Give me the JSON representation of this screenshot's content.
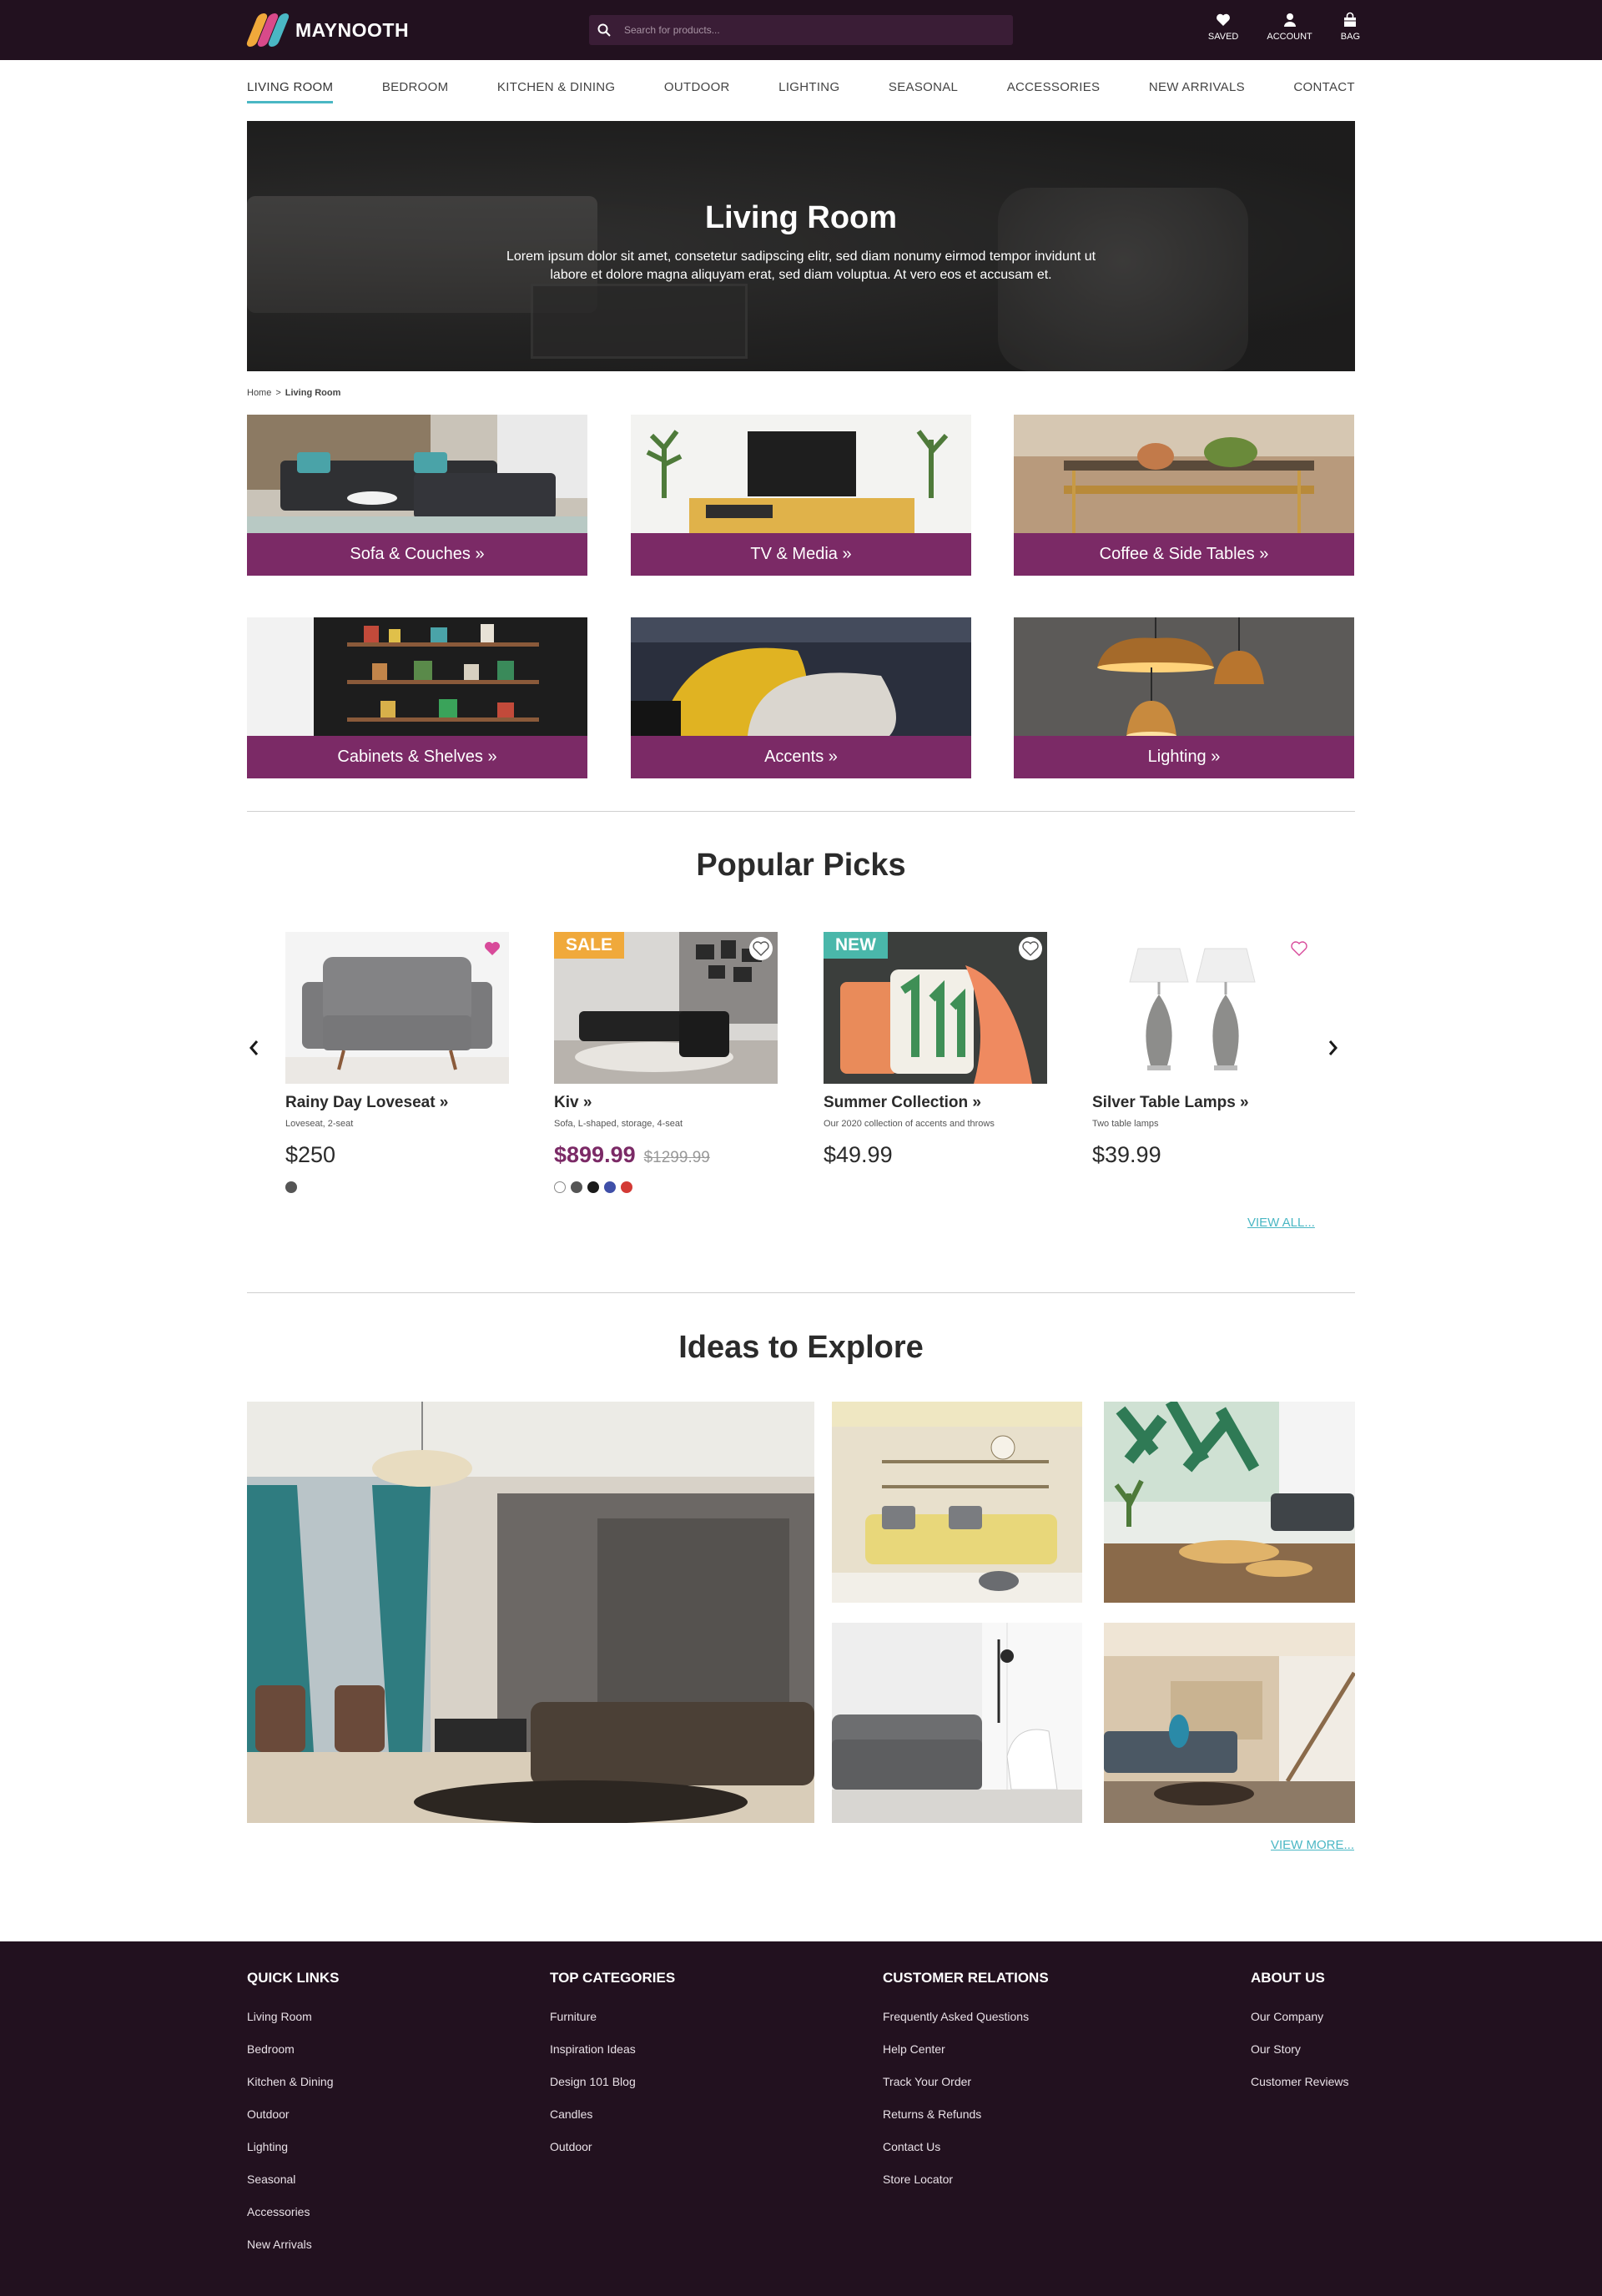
{
  "brand": {
    "name": "MAYNOOTH"
  },
  "search": {
    "placeholder": "Search for products..."
  },
  "header_actions": {
    "saved": "SAVED",
    "account": "ACCOUNT",
    "bag": "BAG"
  },
  "nav": [
    "LIVING ROOM",
    "BEDROOM",
    "KITCHEN & DINING",
    "OUTDOOR",
    "LIGHTING",
    "SEASONAL",
    "ACCESSORIES",
    "NEW ARRIVALS",
    "CONTACT"
  ],
  "hero": {
    "title": "Living Room",
    "text": "Lorem ipsum dolor sit amet, consetetur sadipscing elitr, sed diam nonumy eirmod tempor invidunt ut labore et dolore magna aliquyam erat, sed diam voluptua. At vero eos et accusam et."
  },
  "breadcrumb": {
    "home": "Home",
    "sep": ">",
    "current": "Living Room"
  },
  "categories": [
    "Sofa & Couches »",
    "TV & Media »",
    "Coffee & Side Tables »",
    "Cabinets & Shelves »",
    "Accents »",
    "Lighting »"
  ],
  "popular": {
    "title": "Popular Picks",
    "view_all": "VIEW ALL...",
    "products": [
      {
        "name": "Rainy Day Loveseat »",
        "desc": "Loveseat, 2-seat",
        "price": "$250",
        "old_price": "",
        "badge": "",
        "saved": true
      },
      {
        "name": "Kiv »",
        "desc": "Sofa, L-shaped, storage, 4-seat",
        "price": "$899.99",
        "old_price": "$1299.99",
        "badge": "SALE",
        "saved": false
      },
      {
        "name": "Summer Collection »",
        "desc": "Our 2020 collection of accents and throws",
        "price": "$49.99",
        "old_price": "",
        "badge": "NEW",
        "saved": false
      },
      {
        "name": "Silver Table Lamps »",
        "desc": "Two table lamps",
        "price": "$39.99",
        "old_price": "",
        "badge": "",
        "saved": false
      }
    ]
  },
  "ideas": {
    "title": "Ideas to Explore",
    "view_more": "VIEW MORE..."
  },
  "footer": {
    "quick_links": {
      "title": "QUICK LINKS",
      "items": [
        "Living Room",
        "Bedroom",
        "Kitchen & Dining",
        "Outdoor",
        "Lighting",
        "Seasonal",
        "Accessories",
        "New Arrivals"
      ]
    },
    "top_categories": {
      "title": "TOP CATEGORIES",
      "items": [
        "Furniture",
        "Inspiration Ideas",
        "Design 101 Blog",
        "Candles",
        "Outdoor"
      ]
    },
    "customer_relations": {
      "title": "CUSTOMER RELATIONS",
      "items": [
        "Frequently Asked Questions",
        "Help Center",
        "Track Your Order",
        "Returns & Refunds",
        "Contact Us",
        "Store Locator"
      ]
    },
    "about_us": {
      "title": "ABOUT US",
      "items": [
        "Our Company",
        "Our Story",
        "Customer Reviews"
      ]
    }
  },
  "colors": {
    "header_bg": "#22111f",
    "accent_purple": "#7b2a66",
    "accent_teal": "#4ab7c4",
    "sale_badge": "#f0a93b",
    "new_badge": "#4ab7aa",
    "heart_pink": "#d84a9a"
  }
}
